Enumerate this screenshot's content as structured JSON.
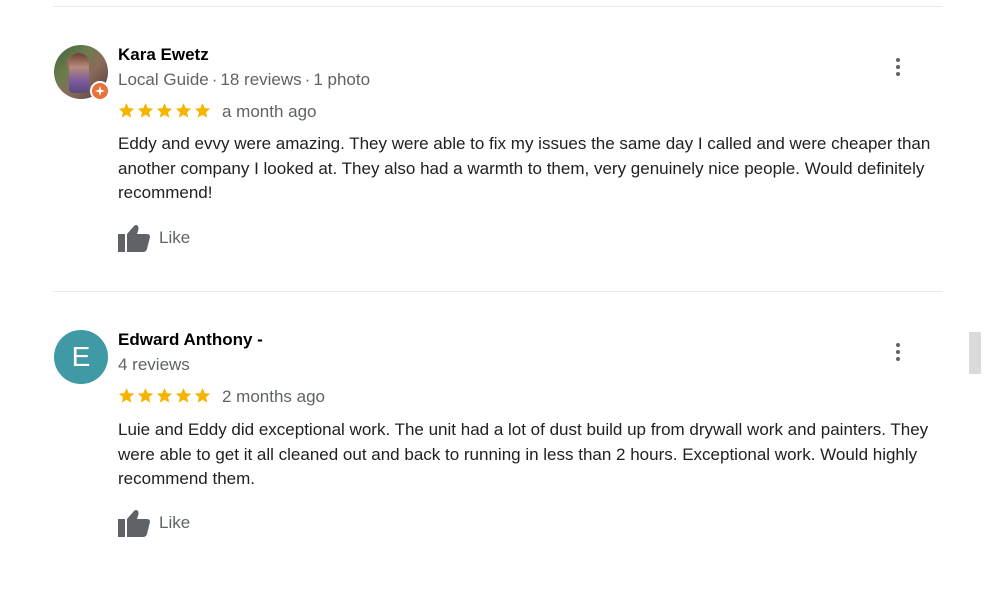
{
  "reviews": [
    {
      "name": "Kara Ewetz",
      "role": "Local Guide",
      "separator1": "·",
      "review_count": "18 reviews",
      "separator2": "·",
      "photo_count": "1 photo",
      "rating": 5,
      "time": "a month ago",
      "text": "Eddy and evvy were amazing. They were able to fix my issues the same day I called and were cheaper than another company I looked at. They also had a warmth to them, very genuinely nice people. Would definitely recommend!",
      "like_label": "Like",
      "avatar_icon": "user-photo"
    },
    {
      "name": "Edward Anthony -",
      "review_count": "4 reviews",
      "avatar_letter": "E",
      "rating": 5,
      "time": "2 months ago",
      "text": "Luie and Eddy did exceptional work. The unit had a lot of dust build up from drywall work and painters. They were able to get it all cleaned out and back to running in less than 2 hours. Exceptional work. Would highly recommend them.",
      "like_label": "Like",
      "avatar_color": "#3f9aa6"
    }
  ],
  "colors": {
    "star": "#f4b400",
    "local_guide_badge": "#e8703a",
    "secondary_text": "#5f6368"
  },
  "icons": {
    "more": "more-vert-icon",
    "like": "thumbs-up-icon",
    "star": "star-icon"
  }
}
